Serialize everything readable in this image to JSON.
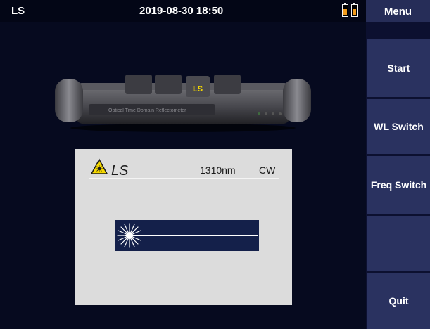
{
  "status_bar": {
    "app_title": "LS",
    "datetime": "2019-08-30 18:50",
    "battery_icons": [
      "battery-icon",
      "battery-icon"
    ]
  },
  "menu": {
    "header": "Menu",
    "buttons": [
      {
        "label": "Start"
      },
      {
        "label": "WL Switch"
      },
      {
        "label": "Freq Switch"
      },
      {
        "label": ""
      },
      {
        "label": "Quit"
      }
    ]
  },
  "device": {
    "badge": "LS",
    "subtitle": "Optical Time Domain Reflectometer"
  },
  "laser_panel": {
    "source_label": "LS",
    "wavelength": "1310nm",
    "mode": "CW",
    "icons": [
      "laser-warning-icon",
      "laser-emission-icon"
    ]
  },
  "colors": {
    "background": "#060a1f",
    "menu_button": "#2a3260",
    "accent_orange": "#f29b1c",
    "warning_yellow": "#f5d800",
    "panel": "#dcdcdc",
    "beam": "#14204a"
  }
}
